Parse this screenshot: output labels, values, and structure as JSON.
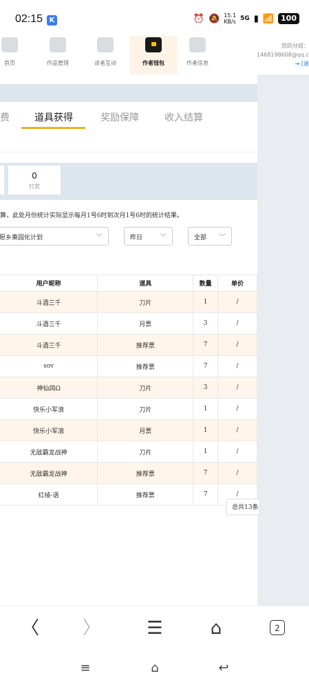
{
  "status_bar": {
    "time": "02:15",
    "app_icon": "K",
    "net_speed": "15.1",
    "net_unit": "KB/s",
    "signal": "5G",
    "battery": "100"
  },
  "nav": {
    "items": [
      {
        "label": "首页",
        "icon": "home-icon"
      },
      {
        "label": "作品管理",
        "icon": "book-icon"
      },
      {
        "label": "读者互动",
        "icon": "chat-icon"
      },
      {
        "label": "作者钱包",
        "icon": "wallet-icon"
      },
      {
        "label": "作者信息",
        "icon": "id-card-icon"
      }
    ],
    "account_group": "您的分组：",
    "account_email": "1468198608@qq.c",
    "logout": "[退"
  },
  "tabs": [
    "费",
    "道具获得",
    "奖励保障",
    "收入结算"
  ],
  "stats": [
    {
      "value": "0",
      "label": "打赏"
    }
  ],
  "note": "算，此处月份统计实际显示每月1号6时到次月1号6时的统计结果。",
  "filters": {
    "work": "愿乡乘园化计划",
    "date": "昨日",
    "type": "全部"
  },
  "table": {
    "headers": [
      "用户昵称",
      "道具",
      "数量",
      "单价"
    ],
    "rows": [
      [
        "斗酒三千",
        "刀片",
        "1",
        "/"
      ],
      [
        "斗酒三千",
        "月票",
        "3",
        "/"
      ],
      [
        "斗酒三千",
        "推荐票",
        "7",
        "/"
      ],
      [
        "sov",
        "推荐票",
        "7",
        "/"
      ],
      [
        "神仙鸽Ω",
        "刀片",
        "3",
        "/"
      ],
      [
        "快乐小军浪",
        "刀片",
        "1",
        "/"
      ],
      [
        "快乐小军浪",
        "月票",
        "1",
        "/"
      ],
      [
        "无敌霸龙战神",
        "刀片",
        "1",
        "/"
      ],
      [
        "无敌霸龙战神",
        "推荐票",
        "7",
        "/"
      ],
      [
        "红绫-语",
        "推荐票",
        "7",
        "/"
      ]
    ]
  },
  "pager": {
    "total": "总共13条"
  },
  "browser": {
    "tab_count": "2"
  }
}
